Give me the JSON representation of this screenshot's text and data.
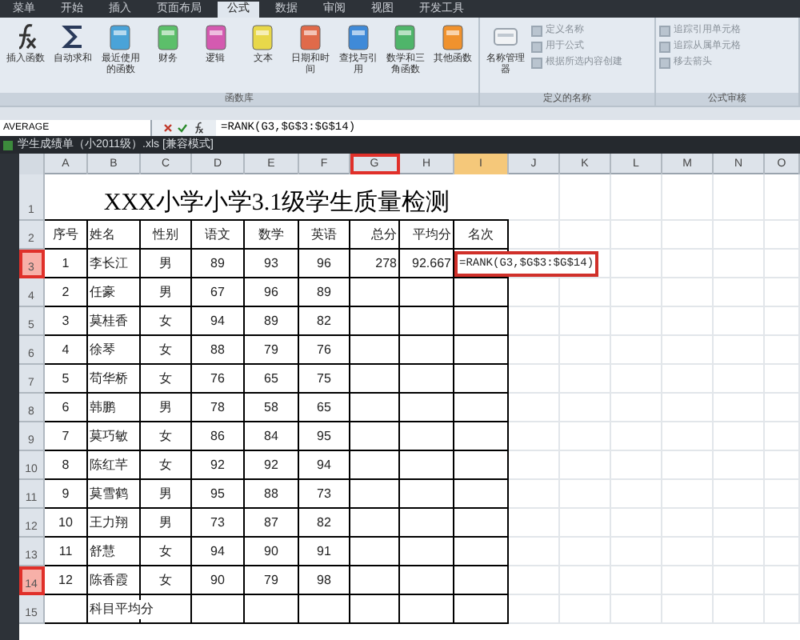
{
  "ribbon_tabs": [
    {
      "label": "菜单",
      "selected": false
    },
    {
      "label": "开始",
      "selected": false
    },
    {
      "label": "插入",
      "selected": false
    },
    {
      "label": "页面布局",
      "selected": false
    },
    {
      "label": "公式",
      "selected": true
    },
    {
      "label": "数据",
      "selected": false
    },
    {
      "label": "审阅",
      "selected": false
    },
    {
      "label": "视图",
      "selected": false
    },
    {
      "label": "开发工具",
      "selected": false
    }
  ],
  "ribbon_groups": [
    {
      "label": "函数库",
      "buttons": [
        {
          "label": "插入函数",
          "kind": "fx"
        },
        {
          "label": "自动求和",
          "kind": "sum"
        },
        {
          "label": "最近使用的函数",
          "kind": "book",
          "color": "#4aa3d8"
        },
        {
          "label": "财务",
          "kind": "book",
          "color": "#5cbf6a"
        },
        {
          "label": "逻辑",
          "kind": "book",
          "color": "#d45ab0"
        },
        {
          "label": "文本",
          "kind": "book",
          "color": "#e8d84a"
        },
        {
          "label": "日期和时间",
          "kind": "book",
          "color": "#e06a4a"
        },
        {
          "label": "查找与引用",
          "kind": "book",
          "color": "#3f8ad8"
        },
        {
          "label": "数学和三角函数",
          "kind": "book",
          "color": "#4fb56a"
        },
        {
          "label": "其他函数",
          "kind": "book",
          "color": "#f0922e"
        }
      ]
    },
    {
      "label": "定义的名称",
      "buttons": [
        {
          "label": "名称管理器",
          "kind": "names"
        },
        {
          "label": "定义名称",
          "kind": "small"
        },
        {
          "label": "用于公式",
          "kind": "small"
        },
        {
          "label": "根据所选内容创建",
          "kind": "small"
        }
      ]
    },
    {
      "label": "公式审核",
      "buttons": [
        {
          "label": "追踪引用单元格",
          "kind": "small"
        },
        {
          "label": "追踪从属单元格",
          "kind": "small"
        },
        {
          "label": "移去箭头",
          "kind": "small"
        }
      ]
    }
  ],
  "formula_bar": {
    "name_box": "AVERAGE",
    "formula": "=RANK(G3,$G$3:$G$14)"
  },
  "document_title": "学生成绩单（小2011级）.xls [兼容模式]",
  "columns": [
    {
      "label": "A",
      "selected": false,
      "marked": false
    },
    {
      "label": "B",
      "selected": false,
      "marked": false
    },
    {
      "label": "C",
      "selected": false,
      "marked": false
    },
    {
      "label": "D",
      "selected": false,
      "marked": false
    },
    {
      "label": "E",
      "selected": false,
      "marked": false
    },
    {
      "label": "F",
      "selected": false,
      "marked": false
    },
    {
      "label": "G",
      "selected": false,
      "marked": true
    },
    {
      "label": "H",
      "selected": false,
      "marked": false
    },
    {
      "label": "I",
      "selected": true,
      "marked": false
    },
    {
      "label": "J",
      "selected": false,
      "marked": false
    },
    {
      "label": "K",
      "selected": false,
      "marked": false
    },
    {
      "label": "L",
      "selected": false,
      "marked": false
    },
    {
      "label": "M",
      "selected": false,
      "marked": false
    },
    {
      "label": "N",
      "selected": false,
      "marked": false
    },
    {
      "label": "O",
      "selected": false,
      "marked": false
    }
  ],
  "rows": [
    {
      "header": "1",
      "marked": false,
      "title": "XXX小学小学3.1级学生质量检测"
    },
    {
      "header": "2",
      "marked": false,
      "cells": [
        "序号",
        "姓名",
        "性别",
        "语文",
        "数学",
        "英语",
        "总分",
        "平均分",
        "名次"
      ]
    },
    {
      "header": "3",
      "marked": true,
      "cells": [
        "1",
        "李长江",
        "男",
        "89",
        "93",
        "96",
        "278",
        "92.667"
      ],
      "formula": "=RANK(G3,$G$3:$G$14)"
    },
    {
      "header": "4",
      "marked": false,
      "cells": [
        "2",
        "任豪",
        "男",
        "67",
        "96",
        "89"
      ]
    },
    {
      "header": "5",
      "marked": false,
      "cells": [
        "3",
        "莫桂香",
        "女",
        "94",
        "89",
        "82"
      ]
    },
    {
      "header": "6",
      "marked": false,
      "cells": [
        "4",
        "徐琴",
        "女",
        "88",
        "79",
        "76"
      ]
    },
    {
      "header": "7",
      "marked": false,
      "cells": [
        "5",
        "苟华桥",
        "女",
        "76",
        "65",
        "75"
      ]
    },
    {
      "header": "8",
      "marked": false,
      "cells": [
        "6",
        "韩鹏",
        "男",
        "78",
        "58",
        "65"
      ]
    },
    {
      "header": "9",
      "marked": false,
      "cells": [
        "7",
        "莫巧敏",
        "女",
        "86",
        "84",
        "95"
      ]
    },
    {
      "header": "10",
      "marked": false,
      "cells": [
        "8",
        "陈红芊",
        "女",
        "92",
        "92",
        "94"
      ]
    },
    {
      "header": "11",
      "marked": false,
      "cells": [
        "9",
        "莫雪鹤",
        "男",
        "95",
        "88",
        "73"
      ]
    },
    {
      "header": "12",
      "marked": false,
      "cells": [
        "10",
        "王力翔",
        "男",
        "73",
        "87",
        "82"
      ]
    },
    {
      "header": "13",
      "marked": false,
      "cells": [
        "11",
        "舒慧",
        "女",
        "94",
        "90",
        "91"
      ]
    },
    {
      "header": "14",
      "marked": true,
      "cells": [
        "12",
        "陈香霞",
        "女",
        "90",
        "79",
        "98"
      ]
    },
    {
      "header": "15",
      "marked": false,
      "cells": [
        "",
        "科目平均分"
      ]
    }
  ]
}
